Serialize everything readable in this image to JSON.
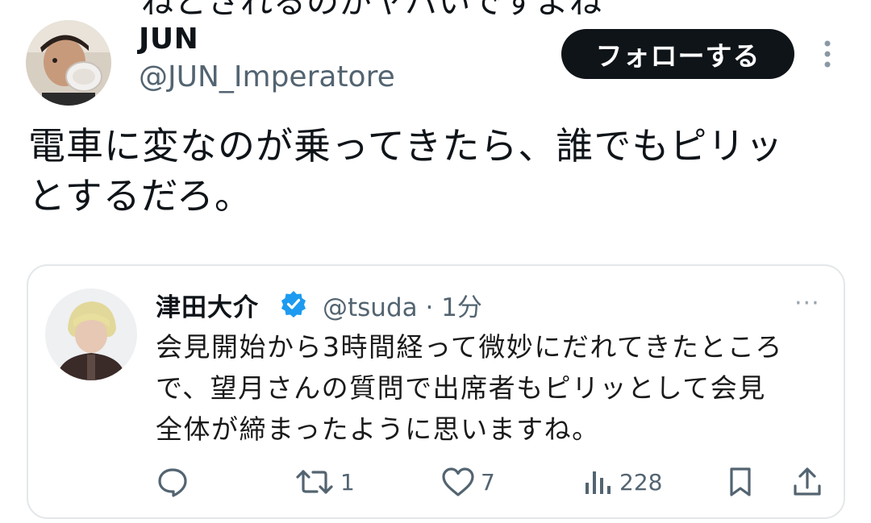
{
  "prev_text_fragment": "ねとされるのがヤバいですよね",
  "author": {
    "display_name": "JUN",
    "handle": "@JUN_Imperatore"
  },
  "follow_button_label": "フォローする",
  "tweet": {
    "line1": "電車に変なのが乗ってきたら、誰でもピリッ",
    "line2": "とするだろ。"
  },
  "quote": {
    "display_name": "津田大介",
    "handle_time": "@tsuda · 1分",
    "more": "···",
    "text_line1": "会見開始から3時間経って微妙にだれてきたところ",
    "text_line2": "で、望月さんの質問で出席者もピリッとして会見",
    "text_line3": "全体が締まったように思いますね。",
    "actions": {
      "retweets": "1",
      "likes": "7",
      "views": "228"
    }
  },
  "icons": {
    "verified": "verified-badge-icon",
    "reply": "reply-icon",
    "retweet": "retweet-icon",
    "like": "heart-icon",
    "views": "views-icon",
    "bookmark": "bookmark-icon",
    "share": "share-icon",
    "more": "more-vertical-icon"
  },
  "colors": {
    "follow_bg": "#0f1419",
    "verified_blue": "#1d9bf0",
    "secondary_text": "#536471",
    "card_border": "#e3e7ea"
  }
}
